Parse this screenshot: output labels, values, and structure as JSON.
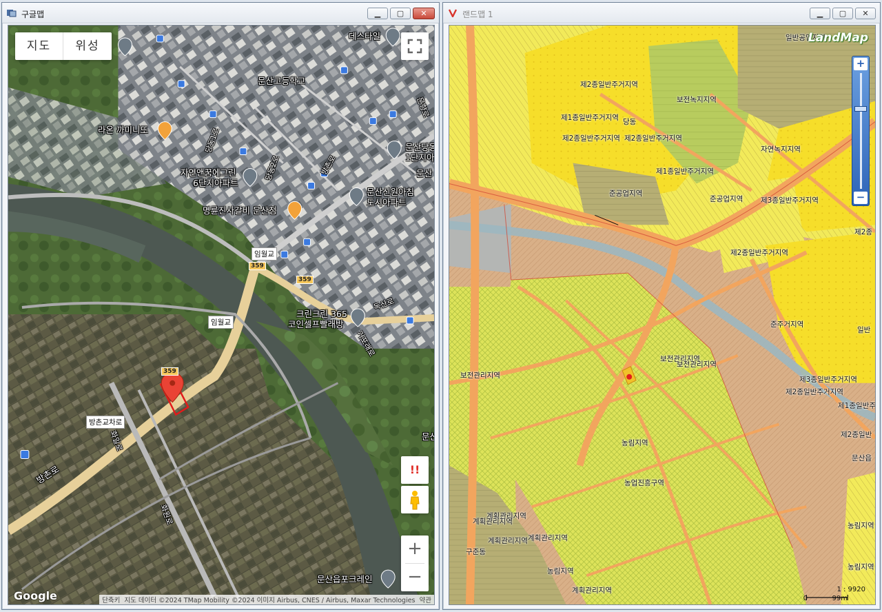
{
  "google_window": {
    "title": "구글맵",
    "map_type": {
      "map": "지도",
      "satellite": "위성"
    },
    "labels": [
      {
        "text": "데스타일"
      },
      {
        "text": "문산고등학교"
      },
      {
        "text": "라온 까미니또"
      },
      {
        "text": "당동1로"
      },
      {
        "text": "자연앤꿈에그린"
      },
      {
        "text": "6단지아파트"
      },
      {
        "text": "당동2로"
      },
      {
        "text": "방촌로"
      },
      {
        "text": "문산당동"
      },
      {
        "text": "1단지아"
      },
      {
        "text": "문산신원아침"
      },
      {
        "text": "도시아파트"
      },
      {
        "text": "명륜진사갈비 문산점"
      },
      {
        "text": "문산"
      },
      {
        "text": "크린크린 365"
      },
      {
        "text": "코인셀프빨래방"
      },
      {
        "text": "독산로"
      },
      {
        "text": "거포래로"
      },
      {
        "text": "방촌로"
      },
      {
        "text": "문산"
      },
      {
        "text": "문산읍포크레인"
      },
      {
        "text": "화일로"
      },
      {
        "text": "문향로"
      },
      {
        "text": "화원로"
      }
    ],
    "road_labels": {
      "bridge1": "임월교",
      "bridge2": "임월교",
      "crossroad": "방촌교차로"
    },
    "shields": {
      "a": "359",
      "b": "359",
      "c": "359"
    },
    "warn": "!!",
    "logo": "Google",
    "attribution": [
      "단축키",
      "지도 데이터 ©2024 TMap Mobility ©2024 이미지 Airbus, CNES / Airbus, Maxar Technologies",
      "약관"
    ]
  },
  "landmap_window": {
    "title": "랜드맵 1",
    "logo": "LandMap",
    "labels": [
      {
        "text": "일반공업지역"
      },
      {
        "text": "제2종일반주거지역"
      },
      {
        "text": "보전녹지지역"
      },
      {
        "text": "제1종일반주거지역"
      },
      {
        "text": "당동"
      },
      {
        "text": "제2종일반주거지역"
      },
      {
        "text": "제2종일반주거지역"
      },
      {
        "text": "자연녹지지역"
      },
      {
        "text": "제1종일반주거지역"
      },
      {
        "text": "준공업지역"
      },
      {
        "text": "준공업지역"
      },
      {
        "text": "제3종일반주거지역"
      },
      {
        "text": "제2종"
      },
      {
        "text": "제2종일반주거지역"
      },
      {
        "text": "준주거지역"
      },
      {
        "text": "일반"
      },
      {
        "text": "보전관리지역"
      },
      {
        "text": "보전관리지역"
      },
      {
        "text": "보전관리지역"
      },
      {
        "text": "제3종일반주거지역"
      },
      {
        "text": "제2종일반주거지역"
      },
      {
        "text": "제1종일반주"
      },
      {
        "text": "제2종일반"
      },
      {
        "text": "문산읍"
      },
      {
        "text": "농림지역"
      },
      {
        "text": "농업진흥구역"
      },
      {
        "text": "계획관리지역"
      },
      {
        "text": "계획관리지역"
      },
      {
        "text": "계획관리지역"
      },
      {
        "text": "구준동"
      },
      {
        "text": "농림지역"
      },
      {
        "text": "농림지역"
      },
      {
        "text": "농림지역"
      },
      {
        "text": "계획관리지역"
      },
      {
        "text": "계획관리지역"
      }
    ],
    "scale": "1 : 9920",
    "scale_dist": "99m",
    "scale_zero": "0"
  }
}
